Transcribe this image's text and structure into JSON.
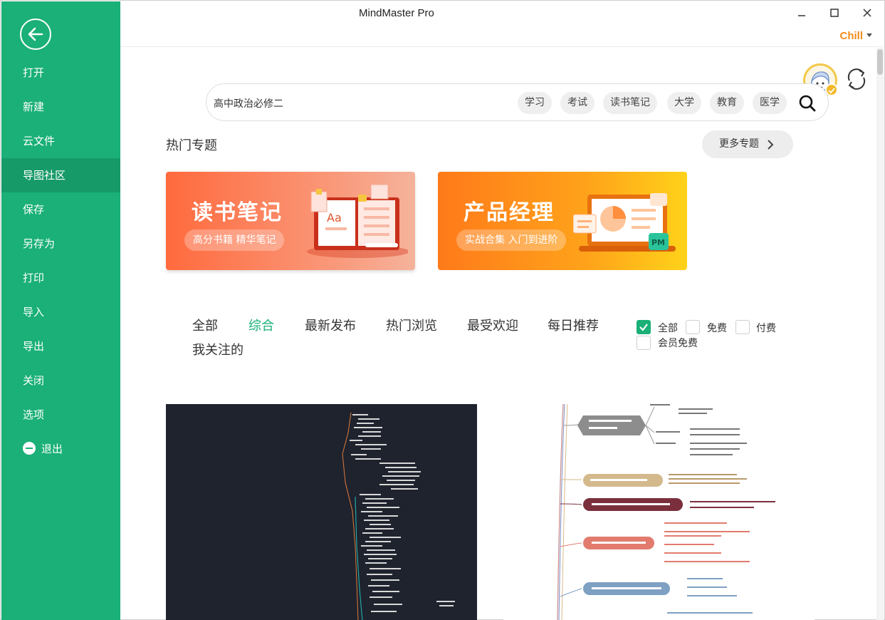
{
  "window": {
    "title": "MindMaster Pro",
    "user_name": "Chill"
  },
  "sidebar": {
    "items": [
      {
        "label": "打开"
      },
      {
        "label": "新建"
      },
      {
        "label": "云文件"
      },
      {
        "label": "导图社区",
        "active": true
      },
      {
        "label": "保存"
      },
      {
        "label": "另存为"
      },
      {
        "label": "打印"
      },
      {
        "label": "导入"
      },
      {
        "label": "导出"
      },
      {
        "label": "关闭"
      },
      {
        "label": "选项"
      },
      {
        "label": "退出",
        "icon": "minus-circle-icon"
      }
    ]
  },
  "search": {
    "value": "高中政治必修二",
    "tags": [
      "学习",
      "考试",
      "读书笔记",
      "大学",
      "教育",
      "医学"
    ]
  },
  "hot_topics": {
    "title": "热门专题",
    "more_label": "更多专题",
    "banners": [
      {
        "title": "读书笔记",
        "subtitle": "高分书籍 精华笔记",
        "badge": "Aa"
      },
      {
        "title": "产品经理",
        "subtitle": "实战合集 入门到进阶",
        "badge": "PM"
      }
    ]
  },
  "filters": {
    "tabs": [
      "全部",
      "综合",
      "最新发布",
      "热门浏览",
      "最受欢迎",
      "每日推荐",
      "我关注的"
    ],
    "active_tab": "综合",
    "price_options": [
      {
        "label": "全部",
        "checked": true
      },
      {
        "label": "免费",
        "checked": false
      },
      {
        "label": "付费",
        "checked": false
      },
      {
        "label": "会员免费",
        "checked": false
      }
    ]
  },
  "colors": {
    "brand_green": "#1ab077",
    "sidebar_active": "#169a68",
    "user_orange": "#f28b1a"
  }
}
